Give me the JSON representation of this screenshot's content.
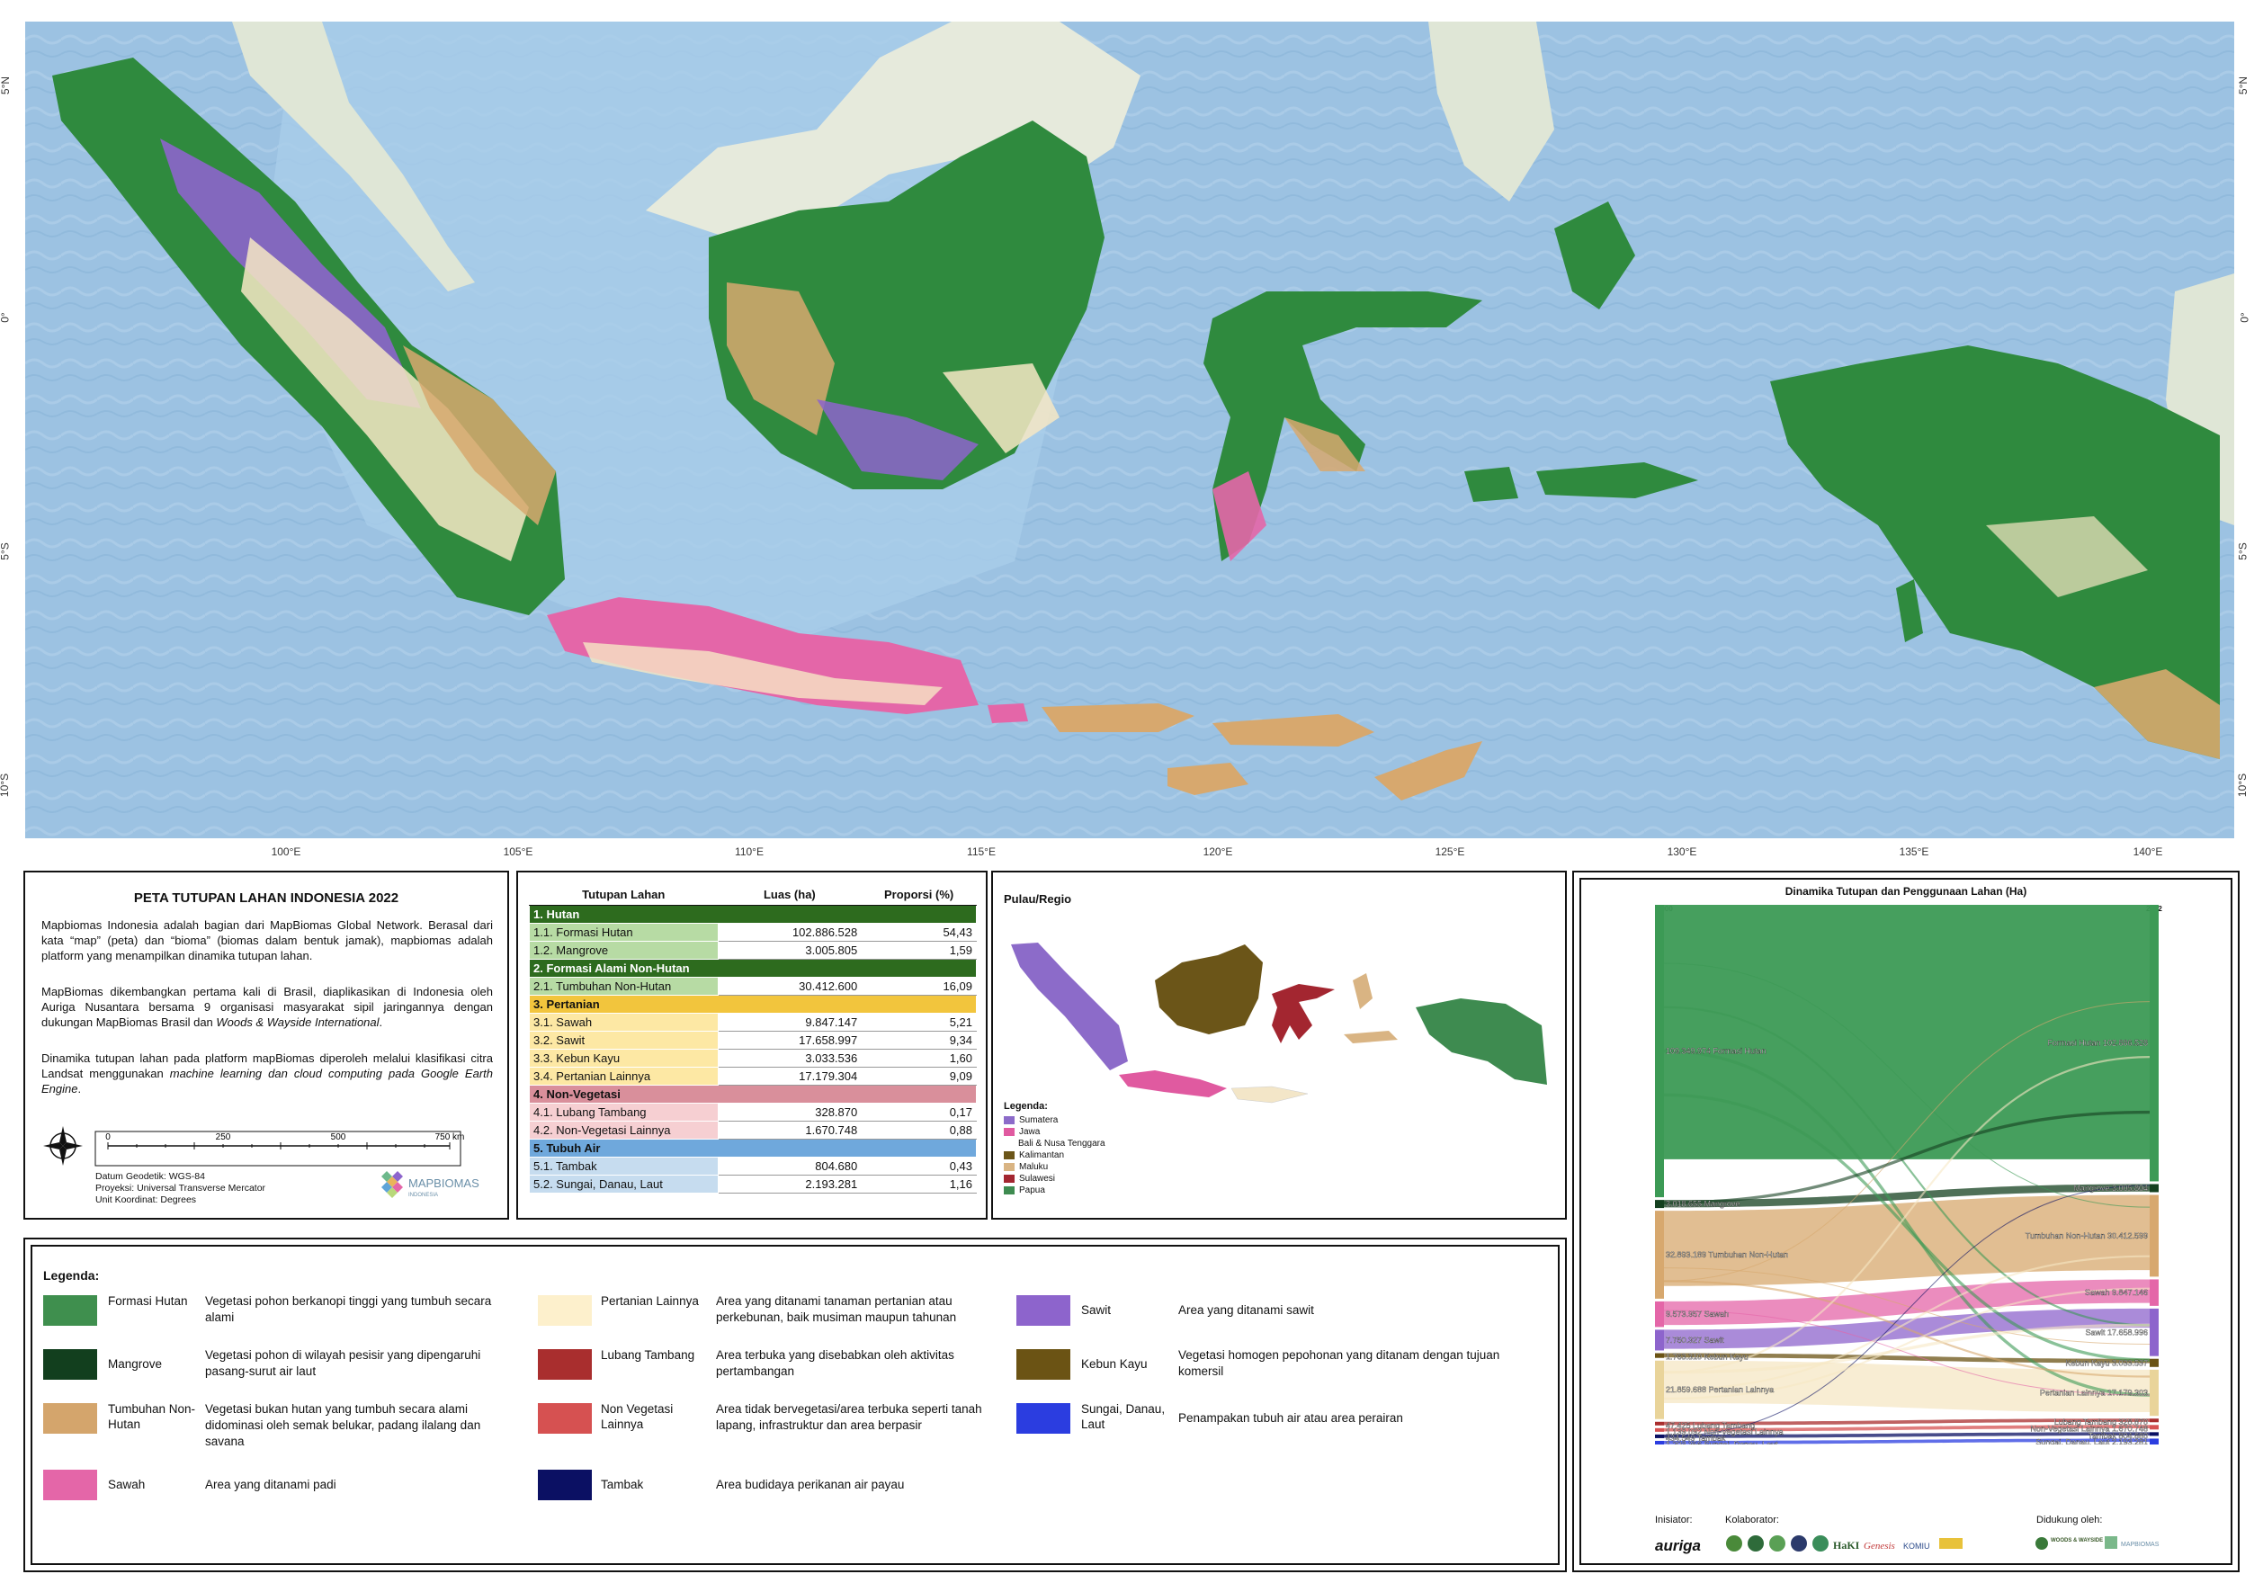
{
  "map": {
    "lat_labels": [
      "5°N",
      "0°",
      "5°S",
      "10°S"
    ],
    "lon_labels": [
      "100°E",
      "105°E",
      "110°E",
      "115°E",
      "120°E",
      "125°E",
      "130°E",
      "135°E",
      "140°E"
    ],
    "colors": {
      "ocean": "#9dc3e3",
      "land_neighbour": "#dde6d2",
      "forest": "#2f8a3e"
    }
  },
  "title_box": {
    "title": "PETA TUTUPAN LAHAN INDONESIA 2022",
    "desc1": "Mapbiomas Indonesia adalah bagian dari MapBiomas Global Network. Berasal dari kata “map” (peta) dan “bioma” (biomas dalam bentuk jamak), mapbiomas adalah platform yang menampilkan dinamika tutupan lahan.",
    "desc2_a": "MapBiomas dikembangkan pertama kali di Brasil, diaplikasikan di Indonesia oleh Auriga Nusantara bersama 9 organisasi masyarakat sipil jaringannya dengan dukungan MapBiomas Brasil dan ",
    "desc2_b": "Woods & Wayside International",
    "desc2_c": ".",
    "desc3_a": "Dinamika tutupan lahan pada platform mapBiomas diperoleh melalui klasifikasi citra Landsat menggunakan ",
    "desc3_b": "machine learning dan cloud computing pada Google Earth Engine",
    "desc3_c": ".",
    "scale_ticks": [
      "0",
      "250",
      "500",
      "750 km"
    ],
    "datum": "Datum Geodetik: WGS-84",
    "projection": "Proyeksi: Universal Transverse Mercator",
    "unit": "Unit Koordinat: Degrees",
    "logo_text": "MAPBIOMAS",
    "logo_sub": "INDONESIA"
  },
  "table": {
    "headers": [
      "Tutupan Lahan",
      "Luas (ha)",
      "Proporsi (%)"
    ],
    "categories": [
      {
        "name": "1. Hutan",
        "color": "#2d6b1e",
        "light": "#b7dba4",
        "rows": [
          [
            "1.1. Formasi Hutan",
            "102.886.528",
            "54,43"
          ],
          [
            "1.2. Mangrove",
            "3.005.805",
            "1,59"
          ]
        ]
      },
      {
        "name": "2. Formasi Alami Non-Hutan",
        "color": "#2d6b1e",
        "light": "#b7dba4",
        "rows": [
          [
            "2.1. Tumbuhan Non-Hutan",
            "30.412.600",
            "16,09"
          ]
        ]
      },
      {
        "name": "3. Pertanian",
        "color": "#f2c53d",
        "light": "#fde8a4",
        "rows": [
          [
            "3.1. Sawah",
            "9.847.147",
            "5,21"
          ],
          [
            "3.2. Sawit",
            "17.658.997",
            "9,34"
          ],
          [
            "3.3. Kebun Kayu",
            "3.033.536",
            "1,60"
          ],
          [
            "3.4. Pertanian Lainnya",
            "17.179.304",
            "9,09"
          ]
        ]
      },
      {
        "name": "4. Non-Vegetasi",
        "color": "#d98f9b",
        "light": "#f6cfd2",
        "rows": [
          [
            "4.1. Lubang Tambang",
            "328.870",
            "0,17"
          ],
          [
            "4.2. Non-Vegetasi Lainnya",
            "1.670.748",
            "0,88"
          ]
        ]
      },
      {
        "name": "5. Tubuh Air",
        "color": "#6fa8dc",
        "light": "#c6dcef",
        "rows": [
          [
            "5.1. Tambak",
            "804.680",
            "0,43"
          ],
          [
            "5.2. Sungai, Danau, Laut",
            "2.193.281",
            "1,16"
          ]
        ]
      }
    ]
  },
  "island": {
    "title": "Pulau/Regio",
    "legend_title": "Legenda:",
    "items": [
      {
        "name": "Sumatera",
        "color": "#8c6bc9"
      },
      {
        "name": "Jawa",
        "color": "#e05aa0"
      },
      {
        "name": "Bali & Nusa Tenggara",
        "color": "#f3e6c8"
      },
      {
        "name": "Kalimantan",
        "color": "#6b5518"
      },
      {
        "name": "Maluku",
        "color": "#d9b483"
      },
      {
        "name": "Sulawesi",
        "color": "#a32630"
      },
      {
        "name": "Papua",
        "color": "#3e8b50"
      }
    ]
  },
  "legend": {
    "title": "Legenda:",
    "items": [
      {
        "name": "Formasi Hutan",
        "color": "#3f8f4e",
        "desc": "Vegetasi pohon berkanopi tinggi yang tumbuh secara alami"
      },
      {
        "name": "Mangrove",
        "color": "#123f1e",
        "desc": "Vegetasi pohon di wilayah pesisir yang dipengaruhi pasang-surut air laut"
      },
      {
        "name": "Tumbuhan Non-Hutan",
        "color": "#d4a56c",
        "desc": "Vegetasi bukan hutan yang tumbuh secara alami didominasi oleh semak belukar, padang ilalang dan savana"
      },
      {
        "name": "Sawah",
        "color": "#e466a8",
        "desc": "Area yang ditanami padi"
      },
      {
        "name": "Pertanian Lainnya",
        "color": "#fdf0cc",
        "desc": "Area yang ditanami tanaman pertanian atau perkebunan, baik musiman maupun tahunan"
      },
      {
        "name": "Lubang Tambang",
        "color": "#a92e2e",
        "desc": "Area terbuka yang disebabkan oleh aktivitas pertambangan"
      },
      {
        "name": "Non Vegetasi Lainnya",
        "color": "#d65151",
        "desc": "Area tidak bervegetasi/area terbuka seperti tanah lapang, infrastruktur dan area berpasir"
      },
      {
        "name": "Tambak",
        "color": "#0b1063",
        "desc": "Area budidaya perikanan air payau"
      },
      {
        "name": "Sawit",
        "color": "#8d64cc",
        "desc": "Area yang ditanami sawit"
      },
      {
        "name": "Kebun Kayu",
        "color": "#6b5314",
        "desc": "Vegetasi homogen pepohonan yang ditanam dengan tujuan komersil"
      },
      {
        "name": "Sungai, Danau, Laut",
        "color": "#2b3de0",
        "desc": "Penampakan tubuh air atau area perairan"
      }
    ]
  },
  "sankey": {
    "title": "Dinamika Tutupan dan Penggunaan Lahan (Ha)",
    "year_left": "2000",
    "year_right": "2022",
    "left": [
      {
        "label": "109.349.974 Formasi Hutan",
        "value": 109349974,
        "color": "#3c9a55"
      },
      {
        "label": "3.018.655 Mangrove",
        "value": 3018655,
        "color": "#14401f"
      },
      {
        "label": "32.893.189 Tumbuhan Non-Hutan",
        "value": 32893189,
        "color": "#d7a86e"
      },
      {
        "label": "9.573.957 Sawah",
        "value": 9573957,
        "color": "#e466a8"
      },
      {
        "label": "7.750.327 Sawit",
        "value": 7750327,
        "color": "#8d64cc"
      },
      {
        "label": "1.763.310 Kebun Kayu",
        "value": 1763310,
        "color": "#6b5314"
      },
      {
        "label": "21.859.688 Pertanian Lainnya",
        "value": 21859688,
        "color": "#f6e7c4"
      },
      {
        "label": "47.425 Lubang Tambang",
        "value": 47425,
        "color": "#a92e2e"
      },
      {
        "label": "1.139.092 Non-Vegetasi Lainnya",
        "value": 1139092,
        "color": "#d65151"
      },
      {
        "label": "434.549 Tambak",
        "value": 434549,
        "color": "#0b1063"
      },
      {
        "label": "1.203.356 Sungai, Danau, Laut",
        "value": 1203356,
        "color": "#2b3de0"
      }
    ],
    "right": [
      {
        "label": "Formasi Hutan 102.886.528",
        "value": 102886528,
        "color": "#3c9a55"
      },
      {
        "label": "Mangrove 3.005.804",
        "value": 3005804,
        "color": "#14401f"
      },
      {
        "label": "Tumbuhan Non-Hutan 30.412.599",
        "value": 30412599,
        "color": "#d7a86e"
      },
      {
        "label": "Sawah 9.847.146",
        "value": 9847146,
        "color": "#e466a8"
      },
      {
        "label": "Sawit 17.658.996",
        "value": 17658996,
        "color": "#8d64cc"
      },
      {
        "label": "Kebun Kayu 3.033.537",
        "value": 3033537,
        "color": "#6b5314"
      },
      {
        "label": "Pertanian Lainnya 17.179.303",
        "value": 17179303,
        "color": "#f6e7c4"
      },
      {
        "label": "Lubang Tambang 328.870",
        "value": 328870,
        "color": "#a92e2e"
      },
      {
        "label": "Non-Vegetasi Lainnya 1.670.748",
        "value": 1670748,
        "color": "#d65151"
      },
      {
        "label": "Tambak 804.680",
        "value": 804680,
        "color": "#0b1063"
      },
      {
        "label": "Sungai, Danau, Laut 2.193.281",
        "value": 2193281,
        "color": "#2b3de0"
      }
    ]
  },
  "credits": {
    "initiator": "Inisiator:",
    "collaborator": "Kolaborator:",
    "supported": "Didukung oleh:",
    "auriga": "auriga",
    "hakiki": "HaKI",
    "genesis": "Genesis",
    "komiu": "KOMIU",
    "woods": "WOODS & WAYSIDE",
    "mapbiomas": "MAPBIOMAS"
  }
}
